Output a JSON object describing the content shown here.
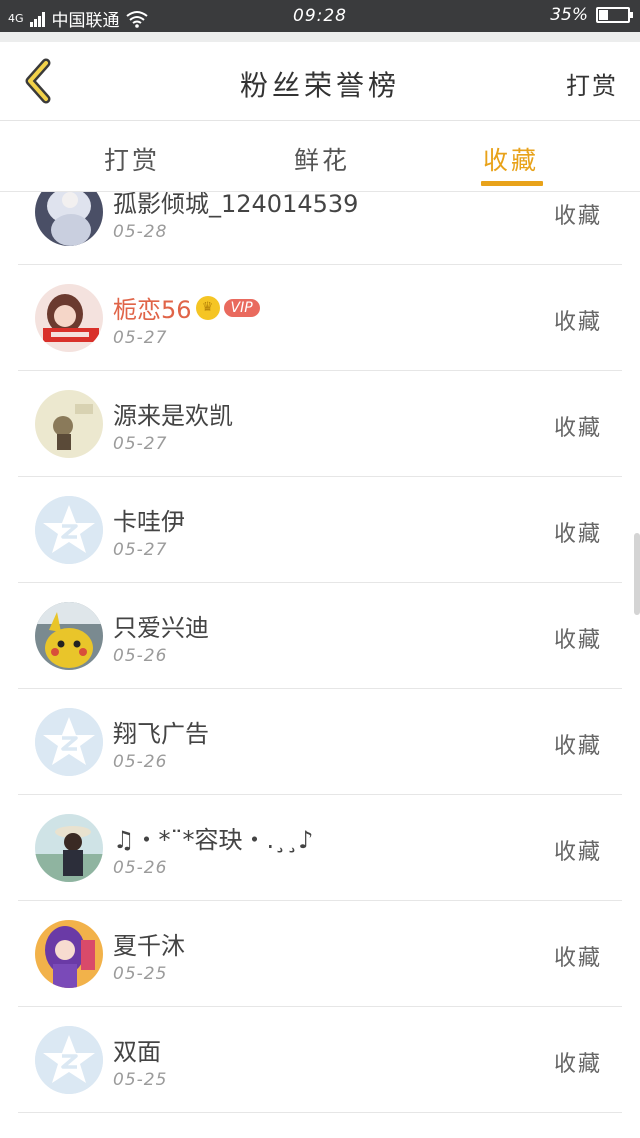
{
  "status_bar": {
    "network": "4G",
    "carrier": "中国联通",
    "time": "09:28",
    "battery": "35%",
    "battery_level": 0.35
  },
  "header": {
    "title": "粉丝荣誉榜",
    "action": "打赏"
  },
  "tabs": [
    {
      "label": "打赏",
      "active": false
    },
    {
      "label": "鲜花",
      "active": false
    },
    {
      "label": "收藏",
      "active": true
    }
  ],
  "accent_color": "#e8a21a",
  "entries": [
    {
      "name": "孤影倾城_124014539",
      "date": "05-28",
      "action": "收藏",
      "vip": false,
      "avatar": "photo-white-figure"
    },
    {
      "name": "栀恋56",
      "date": "05-27",
      "action": "收藏",
      "vip": true,
      "vip_label": "VIP",
      "avatar": "photo-girl-pink"
    },
    {
      "name": "源来是欢凯",
      "date": "05-27",
      "action": "收藏",
      "vip": false,
      "avatar": "photo-beige-figure"
    },
    {
      "name": "卡哇伊",
      "date": "05-27",
      "action": "收藏",
      "vip": false,
      "avatar": "default-qq"
    },
    {
      "name": "只爱兴迪",
      "date": "05-26",
      "action": "收藏",
      "vip": false,
      "avatar": "photo-pikachu"
    },
    {
      "name": "翔飞广告",
      "date": "05-26",
      "action": "收藏",
      "vip": false,
      "avatar": "default-qq"
    },
    {
      "name": "♫・*¨*容玦・.¸¸♪",
      "date": "05-26",
      "action": "收藏",
      "vip": false,
      "avatar": "photo-woman-hat"
    },
    {
      "name": "夏千沐",
      "date": "05-25",
      "action": "收藏",
      "vip": false,
      "avatar": "photo-anime-purple"
    },
    {
      "name": "双面",
      "date": "05-25",
      "action": "收藏",
      "vip": false,
      "avatar": "default-qq"
    }
  ]
}
